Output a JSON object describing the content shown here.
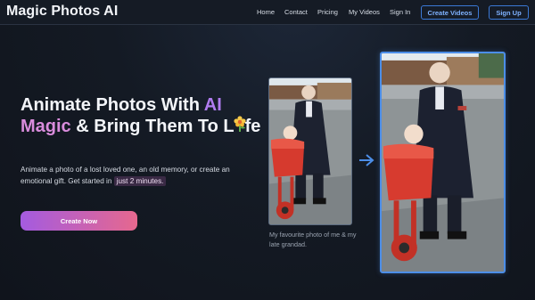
{
  "header": {
    "brand": "Magic Photos AI",
    "nav": {
      "home": "Home",
      "contact": "Contact",
      "pricing": "Pricing",
      "my_videos": "My Videos",
      "sign_in": "Sign In"
    },
    "create_videos_label": "Create Videos",
    "sign_up_label": "Sign Up"
  },
  "hero": {
    "headline_part1": "Animate Photos With ",
    "headline_ai": "AI",
    "headline_magic": "Magic",
    "headline_part2": " & Bring Them To L",
    "headline_part3": "fe",
    "sub_part1": "Animate a photo of a lost loved one, an old memory, or create an emotional gift. Get started in ",
    "sub_highlight": "just 2 minutes.",
    "cta_label": "Create Now"
  },
  "demo": {
    "caption": "My favourite photo of me & my late grandad.",
    "arrow_icon": "arrow-right-icon"
  },
  "colors": {
    "accent_blue": "#3b79d6",
    "ai_purple": "#b07cf0",
    "magic_pink": "#d98cdc",
    "cta_gradient_start": "#a45be0",
    "cta_gradient_end": "#e6688e"
  }
}
